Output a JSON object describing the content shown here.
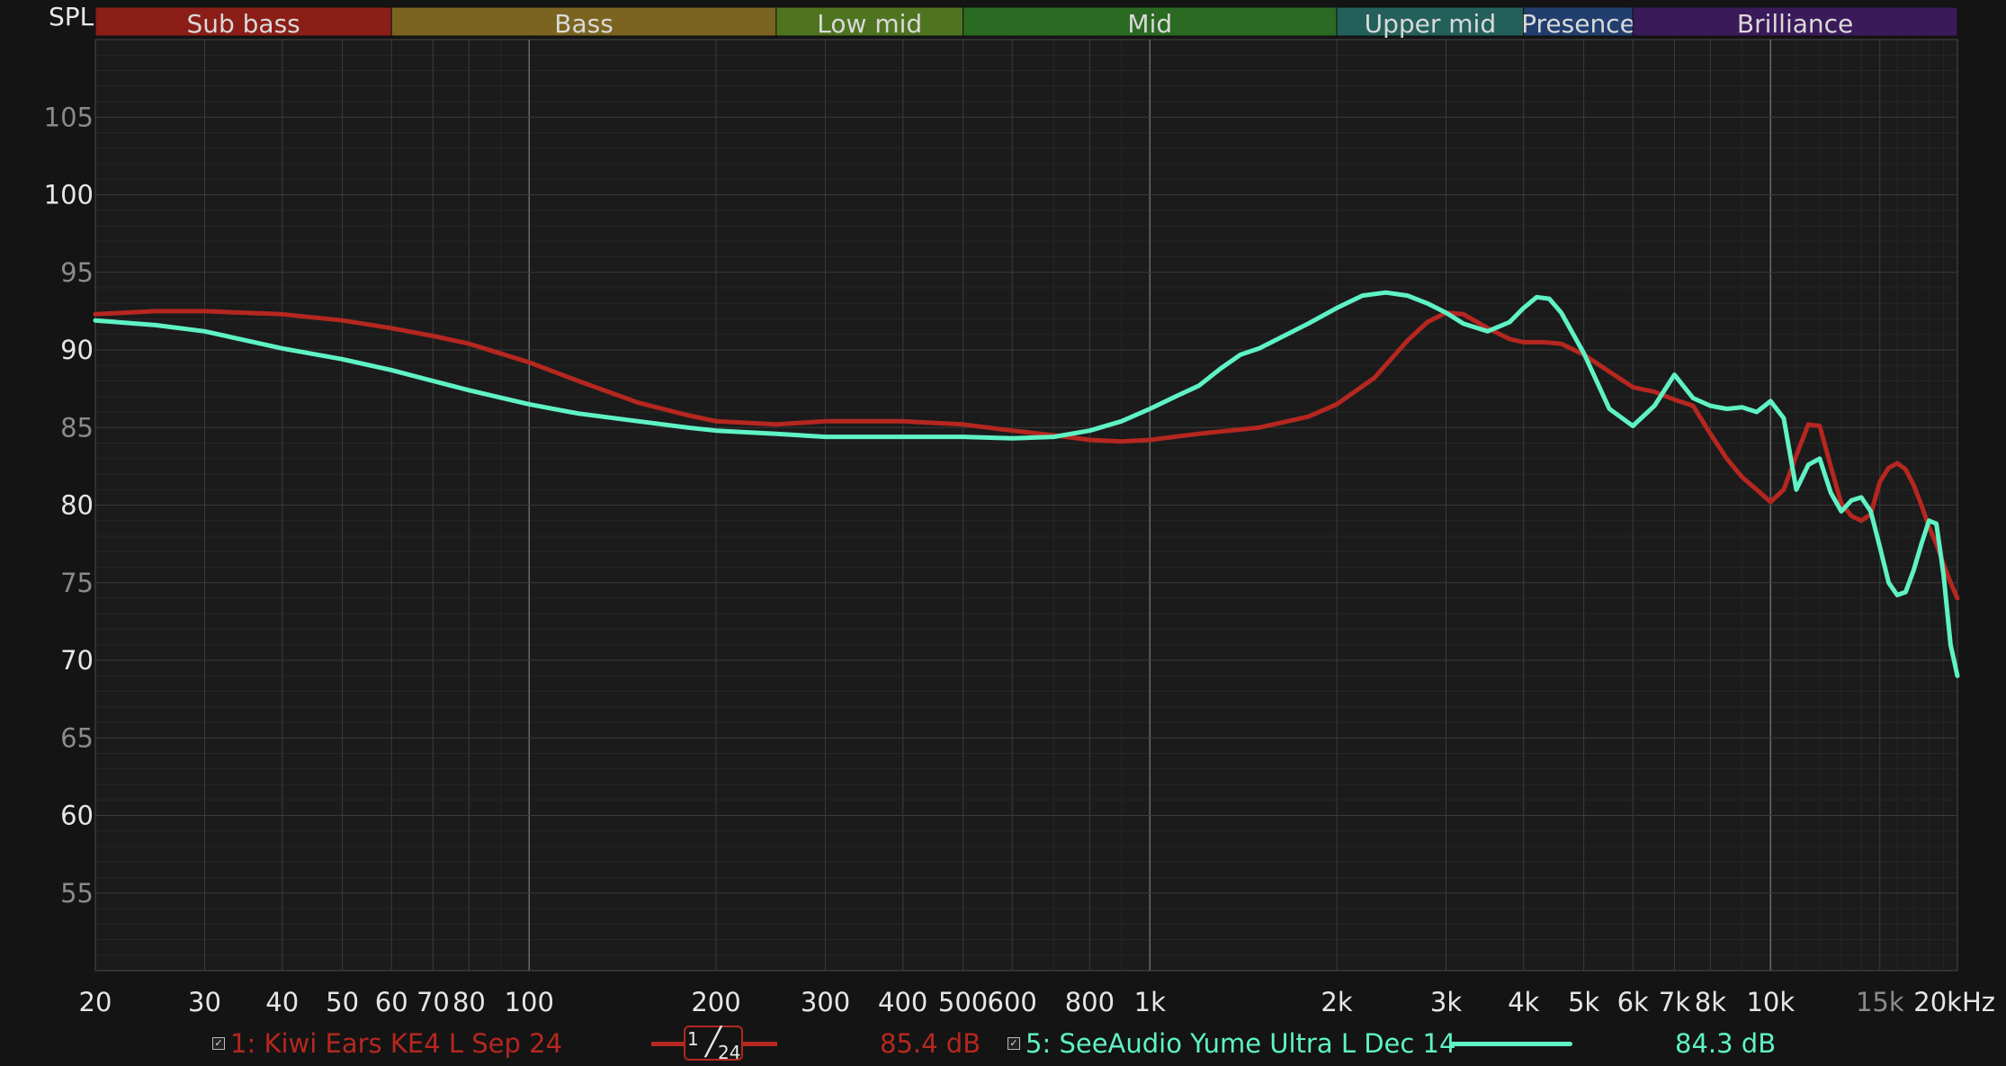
{
  "colors": {
    "background": "#141414",
    "plot_bg": "#1b1b1b",
    "grid_major": "#3a3a3a",
    "grid_minor": "#262626",
    "series_1": "#b5271f",
    "series_2": "#5ff2c5"
  },
  "chart_data": {
    "type": "line",
    "title": "",
    "xlabel": "",
    "ylabel": "SPL",
    "x_scale": "log",
    "xlim": [
      20,
      20000
    ],
    "ylim": [
      50,
      110
    ],
    "grid": true,
    "x_ticks": [
      {
        "v": 20,
        "label": "20"
      },
      {
        "v": 30,
        "label": "30"
      },
      {
        "v": 40,
        "label": "40"
      },
      {
        "v": 50,
        "label": "50"
      },
      {
        "v": 60,
        "label": "60"
      },
      {
        "v": 70,
        "label": "70"
      },
      {
        "v": 80,
        "label": "80"
      },
      {
        "v": 100,
        "label": "100"
      },
      {
        "v": 200,
        "label": "200"
      },
      {
        "v": 300,
        "label": "300"
      },
      {
        "v": 400,
        "label": "400"
      },
      {
        "v": 500,
        "label": "500"
      },
      {
        "v": 600,
        "label": "600"
      },
      {
        "v": 800,
        "label": "800"
      },
      {
        "v": 1000,
        "label": "1k"
      },
      {
        "v": 2000,
        "label": "2k"
      },
      {
        "v": 3000,
        "label": "3k"
      },
      {
        "v": 4000,
        "label": "4k"
      },
      {
        "v": 5000,
        "label": "5k"
      },
      {
        "v": 6000,
        "label": "6k"
      },
      {
        "v": 7000,
        "label": "7k"
      },
      {
        "v": 8000,
        "label": "8k"
      },
      {
        "v": 10000,
        "label": "10k"
      },
      {
        "v": 15000,
        "label": "15k"
      },
      {
        "v": 20000,
        "label": "20kHz"
      }
    ],
    "y_ticks": [
      55,
      60,
      65,
      70,
      75,
      80,
      85,
      90,
      95,
      100,
      105
    ],
    "bands": [
      {
        "label": "Sub bass",
        "from": 20,
        "to": 60,
        "color": "#8b1e17"
      },
      {
        "label": "Bass",
        "from": 60,
        "to": 250,
        "color": "#7a6420"
      },
      {
        "label": "Low mid",
        "from": 250,
        "to": 500,
        "color": "#4f7420"
      },
      {
        "label": "Mid",
        "from": 500,
        "to": 2000,
        "color": "#2a6a22"
      },
      {
        "label": "Upper mid",
        "from": 2000,
        "to": 4000,
        "color": "#24605a"
      },
      {
        "label": "Presence",
        "from": 4000,
        "to": 6000,
        "color": "#213e6e"
      },
      {
        "label": "Brilliance",
        "from": 6000,
        "to": 20000,
        "color": "#3b1a5a"
      }
    ],
    "series": [
      {
        "name": "1: Kiwi Ears KE4 L Sep 24",
        "color": "#b5271f",
        "x": [
          20,
          25,
          30,
          40,
          50,
          60,
          70,
          80,
          100,
          120,
          150,
          180,
          200,
          250,
          300,
          400,
          500,
          600,
          700,
          800,
          900,
          1000,
          1200,
          1500,
          1800,
          2000,
          2300,
          2600,
          2800,
          3000,
          3200,
          3500,
          3800,
          4000,
          4300,
          4600,
          5000,
          5500,
          6000,
          6500,
          7000,
          7500,
          8000,
          8500,
          9000,
          9500,
          10000,
          10500,
          11000,
          11500,
          12000,
          12500,
          13000,
          13500,
          14000,
          14500,
          15000,
          15500,
          16000,
          16500,
          17000,
          17500,
          18000,
          18500,
          19000,
          19500,
          20000
        ],
        "y": [
          92.3,
          92.5,
          92.5,
          92.3,
          91.9,
          91.4,
          90.9,
          90.4,
          89.2,
          88.0,
          86.6,
          85.8,
          85.4,
          85.2,
          85.4,
          85.4,
          85.2,
          84.8,
          84.5,
          84.2,
          84.1,
          84.2,
          84.6,
          85.0,
          85.7,
          86.5,
          88.2,
          90.6,
          91.8,
          92.4,
          92.3,
          91.4,
          90.7,
          90.5,
          90.5,
          90.4,
          89.7,
          88.6,
          87.6,
          87.3,
          86.8,
          86.4,
          84.6,
          83.0,
          81.8,
          81.0,
          80.2,
          81.0,
          83.2,
          85.2,
          85.1,
          82.5,
          80.1,
          79.3,
          79.0,
          79.4,
          81.5,
          82.4,
          82.7,
          82.3,
          81.3,
          80.0,
          78.6,
          77.5,
          76.2,
          75.0,
          74.0
        ]
      },
      {
        "name": "5: SeeAudio Yume Ultra L Dec 14",
        "color": "#5ff2c5",
        "x": [
          20,
          25,
          30,
          40,
          50,
          60,
          70,
          80,
          100,
          120,
          150,
          180,
          200,
          250,
          300,
          400,
          500,
          600,
          700,
          800,
          900,
          1000,
          1100,
          1200,
          1300,
          1400,
          1500,
          1800,
          2000,
          2200,
          2400,
          2600,
          2800,
          3000,
          3200,
          3500,
          3800,
          4000,
          4200,
          4400,
          4600,
          5000,
          5500,
          6000,
          6500,
          7000,
          7500,
          8000,
          8500,
          9000,
          9500,
          10000,
          10500,
          11000,
          11500,
          12000,
          12500,
          13000,
          13500,
          14000,
          14500,
          15000,
          15500,
          16000,
          16500,
          17000,
          17500,
          18000,
          18500,
          19000,
          19500,
          20000
        ],
        "y": [
          91.9,
          91.6,
          91.2,
          90.1,
          89.4,
          88.7,
          88.0,
          87.4,
          86.5,
          85.9,
          85.4,
          85.0,
          84.8,
          84.6,
          84.4,
          84.4,
          84.4,
          84.3,
          84.4,
          84.8,
          85.4,
          86.2,
          87.0,
          87.7,
          88.8,
          89.7,
          90.1,
          91.7,
          92.7,
          93.5,
          93.7,
          93.5,
          93.0,
          92.4,
          91.7,
          91.2,
          91.8,
          92.7,
          93.4,
          93.3,
          92.4,
          89.8,
          86.2,
          85.1,
          86.4,
          88.4,
          86.9,
          86.4,
          86.2,
          86.3,
          86.0,
          86.7,
          85.6,
          81.0,
          82.6,
          83.0,
          80.8,
          79.6,
          80.3,
          80.5,
          79.6,
          77.3,
          75.0,
          74.2,
          74.4,
          75.8,
          77.5,
          79.0,
          78.8,
          75.5,
          71.0,
          69.0
        ]
      }
    ]
  },
  "legend": {
    "series_1_label": "1: Kiwi Ears KE4 L Sep 24",
    "series_1_level": "85.4 dB",
    "series_2_label": "5: SeeAudio Yume Ultra L Dec 14",
    "series_2_level": "84.3 dB",
    "smoothing_numerator": "1",
    "smoothing_denominator": "24",
    "checkbox_mark": "✓"
  }
}
